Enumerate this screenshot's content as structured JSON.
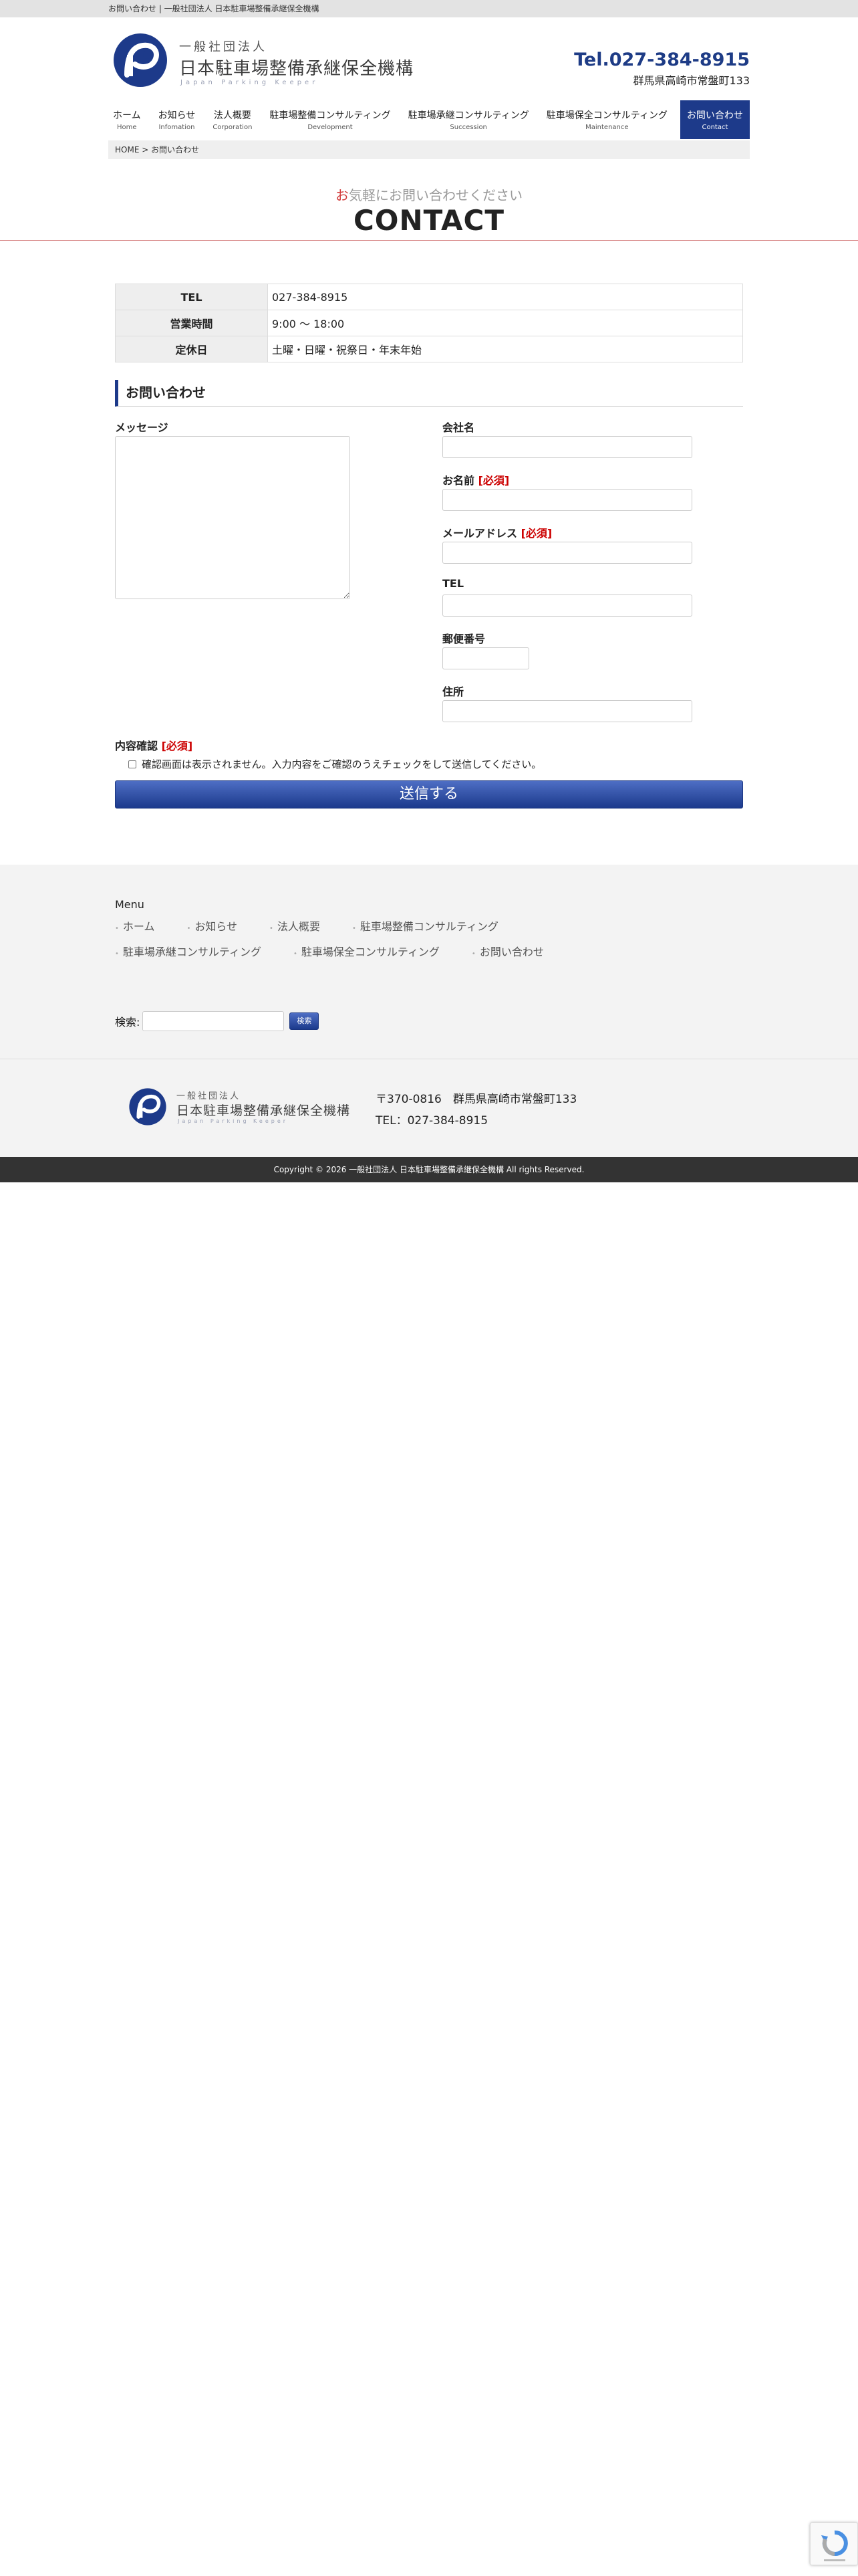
{
  "topbar": {
    "text": "お問い合わせ | 一般社団法人 日本駐車場整備承継保全機構"
  },
  "header": {
    "logo_sub": "一般社団法人",
    "logo_main": "日本駐車場整備承継保全機構",
    "logo_en": "Japan Parking Keeper",
    "tel": "Tel.027-384-8915",
    "address": "群馬県高崎市常盤町133"
  },
  "nav": [
    {
      "jp": "ホーム",
      "en": "Home"
    },
    {
      "jp": "お知らせ",
      "en": "Infomation"
    },
    {
      "jp": "法人概要",
      "en": "Corporation"
    },
    {
      "jp": "駐車場整備コンサルティング",
      "en": "Development"
    },
    {
      "jp": "駐車場承継コンサルティング",
      "en": "Succession"
    },
    {
      "jp": "駐車場保全コンサルティング",
      "en": "Maintenance"
    },
    {
      "jp": "お問い合わせ",
      "en": "Contact"
    }
  ],
  "breadcrumb": {
    "home": "HOME",
    "separator": ">",
    "current": "お問い合わせ"
  },
  "page": {
    "catch_first": "お",
    "catch_rest": "気軽にお問い合わせください",
    "title": "CONTACT"
  },
  "info": [
    {
      "label": "TEL",
      "value": "027-384-8915"
    },
    {
      "label": "営業時間",
      "value": "9:00 〜 18:00"
    },
    {
      "label": "定休日",
      "value": "土曜・日曜・祝祭日・年末年始"
    }
  ],
  "form": {
    "section_title": "お問い合わせ",
    "message_label": "メッセージ",
    "company_label": "会社名",
    "name_label": "お名前",
    "email_label": "メールアドレス",
    "tel_label": "TEL",
    "zip_label": "郵便番号",
    "address_label": "住所",
    "required": "[必須]",
    "confirm_label": "内容確認",
    "confirm_text": "確認画面は表示されません。入力内容をご確認のうえチェックをして送信してください。",
    "submit": "送信する"
  },
  "footer": {
    "menu_title": "Menu",
    "menu": [
      "ホーム",
      "お知らせ",
      "法人概要",
      "駐車場整備コンサルティング",
      "駐車場承継コンサルティング",
      "駐車場保全コンサルティング",
      "お問い合わせ"
    ],
    "search_label": "検索:",
    "search_button": "検索",
    "postal": "〒370-0816　群馬県高崎市常盤町133",
    "tel": "TEL：027-384-8915",
    "copyright": "Copyright © 2026 一般社団法人 日本駐車場整備承継保全機構 All rights Reserved."
  },
  "colors": {
    "brand_navy": "#1d3a8a",
    "required_red": "#cc0000",
    "footer_bg": "#f3f3f3",
    "copyright_bg": "#333333"
  },
  "icons": {
    "logo": "parking-p-logo-icon",
    "recaptcha": "recaptcha-icon"
  }
}
